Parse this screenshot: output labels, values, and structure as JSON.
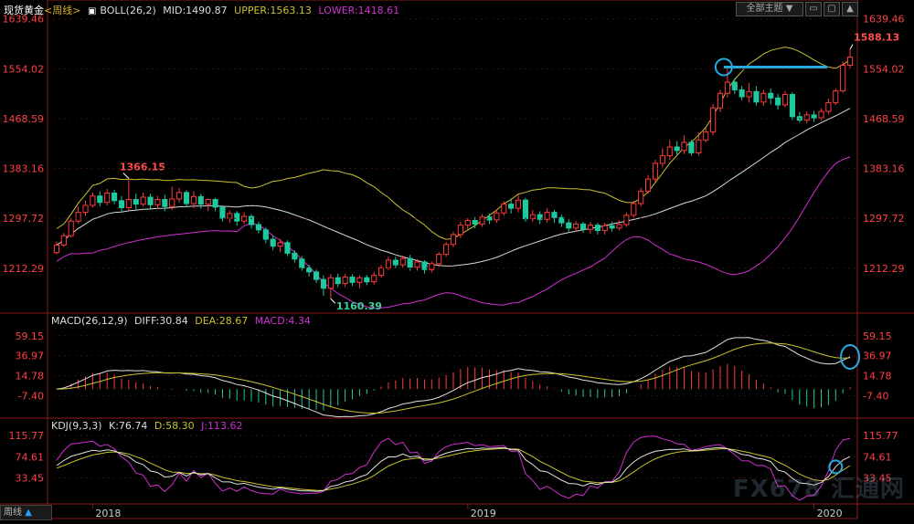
{
  "header": {
    "instrument": "现货黄金",
    "period_tag": "<周线>",
    "boll_label": "BOLL(26,2)",
    "mid": "MID:1490.87",
    "upper": "UPPER:1563.13",
    "lower": "LOWER:1418.61"
  },
  "toolbar": {
    "theme_label": "全部主题",
    "theme_arrow": "▼"
  },
  "macd_header": {
    "label": "MACD(26,12,9)",
    "diff": "DIFF:30.84",
    "dea": "DEA:28.67",
    "macd": "MACD:4.34"
  },
  "kdj_header": {
    "label": "KDJ(9,3,3)",
    "k": "K:76.74",
    "d": "D:58.30",
    "j": "J:113.62"
  },
  "footer": {
    "period": "周线",
    "arrow": "▲"
  },
  "watermark": "FX678 汇通网",
  "colors": {
    "up": "#ff3b3b",
    "down": "#1fc9a0",
    "upper_band": "#c9c22e",
    "mid_band": "#d8d8d8",
    "lower_band": "#d030d0",
    "annotation": "#27a9e1"
  },
  "chart_data": {
    "type": "candlestick",
    "price_axis_ticks": [
      1639.46,
      1554.02,
      1468.59,
      1383.16,
      1297.72,
      1212.29
    ],
    "price_range": [
      1140,
      1650
    ],
    "time_labels": [
      {
        "label": "2018",
        "at": 5
      },
      {
        "label": "2019",
        "at": 57
      },
      {
        "label": "2020",
        "at": 105
      }
    ],
    "annotations": {
      "high": "1366.15",
      "low": "1160.39",
      "last_high": "1588.13"
    },
    "horizontal_level": 1557,
    "candles": [
      [
        1239,
        1252,
        1236,
        1258
      ],
      [
        1252,
        1268,
        1249,
        1273
      ],
      [
        1268,
        1293,
        1265,
        1298
      ],
      [
        1293,
        1308,
        1289,
        1318
      ],
      [
        1308,
        1320,
        1302,
        1328
      ],
      [
        1320,
        1336,
        1316,
        1342
      ],
      [
        1336,
        1325,
        1318,
        1344
      ],
      [
        1325,
        1341,
        1320,
        1348
      ],
      [
        1341,
        1328,
        1322,
        1347
      ],
      [
        1328,
        1316,
        1308,
        1336
      ],
      [
        1316,
        1330,
        1311,
        1366
      ],
      [
        1330,
        1322,
        1312,
        1340
      ],
      [
        1322,
        1334,
        1318,
        1342
      ],
      [
        1334,
        1321,
        1312,
        1340
      ],
      [
        1321,
        1330,
        1314,
        1336
      ],
      [
        1330,
        1318,
        1310,
        1338
      ],
      [
        1318,
        1331,
        1312,
        1352
      ],
      [
        1331,
        1342,
        1325,
        1350
      ],
      [
        1342,
        1323,
        1318,
        1346
      ],
      [
        1323,
        1335,
        1315,
        1344
      ],
      [
        1335,
        1322,
        1314,
        1340
      ],
      [
        1322,
        1330,
        1310,
        1332
      ],
      [
        1330,
        1317,
        1310,
        1333
      ],
      [
        1317,
        1298,
        1292,
        1320
      ],
      [
        1298,
        1306,
        1290,
        1311
      ],
      [
        1306,
        1293,
        1285,
        1310
      ],
      [
        1293,
        1301,
        1288,
        1308
      ],
      [
        1301,
        1287,
        1280,
        1305
      ],
      [
        1287,
        1278,
        1272,
        1292
      ],
      [
        1278,
        1262,
        1255,
        1282
      ],
      [
        1262,
        1250,
        1243,
        1268
      ],
      [
        1250,
        1256,
        1240,
        1262
      ],
      [
        1256,
        1238,
        1233,
        1260
      ],
      [
        1238,
        1228,
        1222,
        1243
      ],
      [
        1228,
        1213,
        1208,
        1233
      ],
      [
        1213,
        1206,
        1198,
        1218
      ],
      [
        1206,
        1193,
        1187,
        1210
      ],
      [
        1193,
        1178,
        1165,
        1200
      ],
      [
        1178,
        1196,
        1160,
        1202
      ],
      [
        1196,
        1186,
        1180,
        1203
      ],
      [
        1186,
        1197,
        1180,
        1203
      ],
      [
        1197,
        1188,
        1182,
        1202
      ],
      [
        1188,
        1196,
        1178,
        1200
      ],
      [
        1196,
        1189,
        1183,
        1201
      ],
      [
        1189,
        1200,
        1184,
        1206
      ],
      [
        1200,
        1213,
        1196,
        1218
      ],
      [
        1213,
        1226,
        1209,
        1232
      ],
      [
        1226,
        1218,
        1212,
        1232
      ],
      [
        1218,
        1229,
        1213,
        1234
      ],
      [
        1229,
        1214,
        1208,
        1235
      ],
      [
        1214,
        1223,
        1208,
        1228
      ],
      [
        1223,
        1210,
        1203,
        1226
      ],
      [
        1210,
        1220,
        1205,
        1224
      ],
      [
        1220,
        1236,
        1214,
        1240
      ],
      [
        1236,
        1253,
        1232,
        1257
      ],
      [
        1253,
        1270,
        1248,
        1275
      ],
      [
        1270,
        1286,
        1264,
        1292
      ],
      [
        1286,
        1294,
        1279,
        1298
      ],
      [
        1294,
        1288,
        1281,
        1300
      ],
      [
        1288,
        1300,
        1283,
        1305
      ],
      [
        1300,
        1295,
        1288,
        1306
      ],
      [
        1295,
        1307,
        1290,
        1313
      ],
      [
        1307,
        1322,
        1302,
        1327
      ],
      [
        1322,
        1315,
        1306,
        1332
      ],
      [
        1315,
        1329,
        1308,
        1338
      ],
      [
        1329,
        1297,
        1292,
        1333
      ],
      [
        1297,
        1304,
        1292,
        1312
      ],
      [
        1304,
        1296,
        1288,
        1310
      ],
      [
        1296,
        1308,
        1290,
        1315
      ],
      [
        1308,
        1299,
        1290,
        1312
      ],
      [
        1299,
        1290,
        1283,
        1304
      ],
      [
        1290,
        1281,
        1275,
        1296
      ],
      [
        1281,
        1288,
        1275,
        1293
      ],
      [
        1288,
        1279,
        1273,
        1292
      ],
      [
        1279,
        1286,
        1271,
        1291
      ],
      [
        1286,
        1277,
        1270,
        1290
      ],
      [
        1277,
        1285,
        1270,
        1290
      ],
      [
        1285,
        1281,
        1275,
        1292
      ],
      [
        1281,
        1287,
        1277,
        1294
      ],
      [
        1287,
        1303,
        1283,
        1308
      ],
      [
        1303,
        1323,
        1299,
        1328
      ],
      [
        1323,
        1344,
        1318,
        1350
      ],
      [
        1344,
        1365,
        1340,
        1372
      ],
      [
        1365,
        1392,
        1360,
        1398
      ],
      [
        1392,
        1405,
        1385,
        1418
      ],
      [
        1405,
        1420,
        1398,
        1432
      ],
      [
        1420,
        1414,
        1406,
        1430
      ],
      [
        1414,
        1428,
        1408,
        1440
      ],
      [
        1428,
        1410,
        1405,
        1432
      ],
      [
        1410,
        1432,
        1405,
        1445
      ],
      [
        1432,
        1446,
        1428,
        1452
      ],
      [
        1446,
        1487,
        1440,
        1494
      ],
      [
        1487,
        1512,
        1480,
        1518
      ],
      [
        1512,
        1531,
        1505,
        1555
      ],
      [
        1531,
        1518,
        1511,
        1538
      ],
      [
        1518,
        1506,
        1500,
        1525
      ],
      [
        1506,
        1515,
        1496,
        1530
      ],
      [
        1515,
        1497,
        1491,
        1524
      ],
      [
        1497,
        1512,
        1490,
        1518
      ],
      [
        1512,
        1504,
        1493,
        1520
      ],
      [
        1504,
        1492,
        1484,
        1511
      ],
      [
        1492,
        1510,
        1488,
        1516
      ],
      [
        1510,
        1472,
        1466,
        1514
      ],
      [
        1472,
        1466,
        1462,
        1480
      ],
      [
        1466,
        1475,
        1461,
        1481
      ],
      [
        1475,
        1470,
        1463,
        1482
      ],
      [
        1470,
        1481,
        1465,
        1486
      ],
      [
        1481,
        1496,
        1476,
        1503
      ],
      [
        1496,
        1516,
        1492,
        1520
      ],
      [
        1516,
        1560,
        1513,
        1566
      ],
      [
        1560,
        1574,
        1555,
        1588
      ]
    ]
  }
}
